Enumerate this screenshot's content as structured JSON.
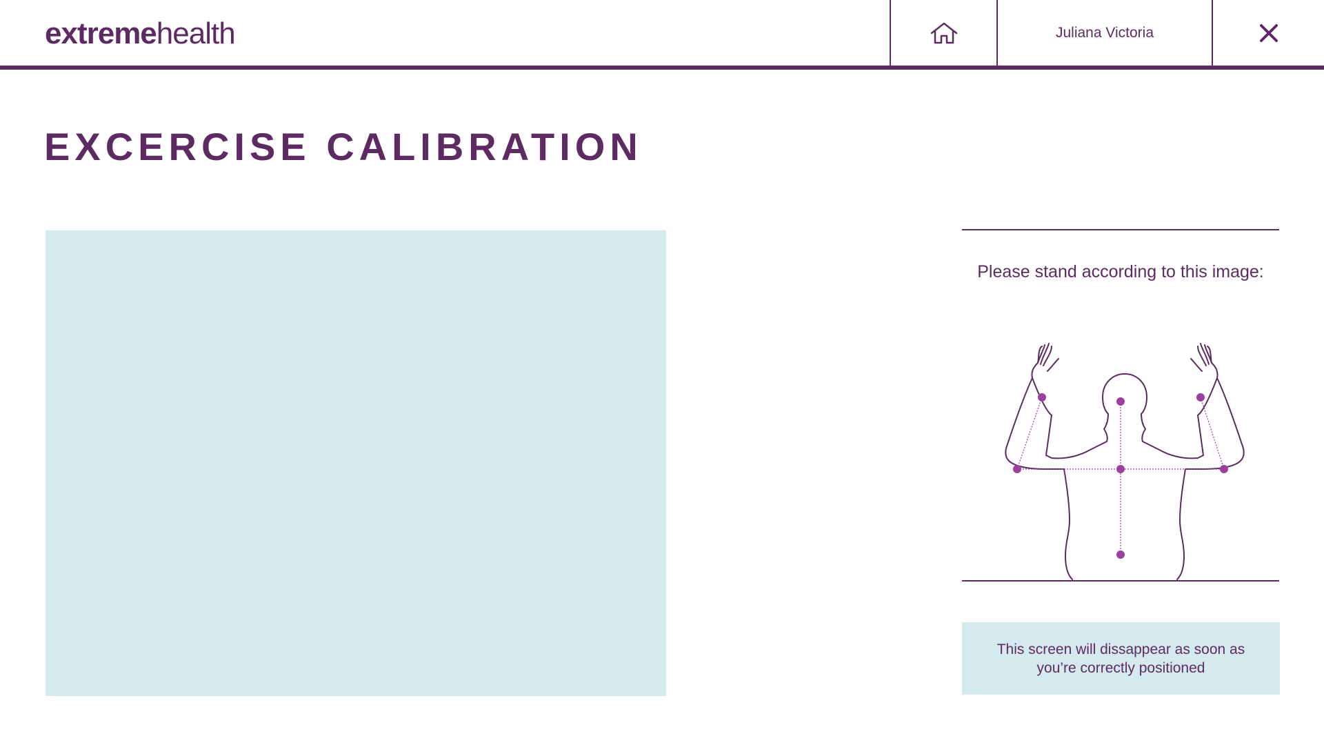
{
  "brand": {
    "logo_bold": "extreme",
    "logo_light": "health"
  },
  "header": {
    "home_icon": "home-icon",
    "user_name": "Juliana Victoria",
    "close_icon": "close-icon"
  },
  "page": {
    "title": "EXCERCISE CALIBRATION"
  },
  "guide": {
    "instruction": "Please stand according to this image:",
    "figure_icon": "body-pose-figure"
  },
  "notice": {
    "text": "This screen will dissappear as soon as you’re correctly positioned"
  },
  "colors": {
    "primary": "#5e2a63",
    "accent_dot": "#9b3fa0",
    "panel_bg": "#d4eaee",
    "background": "#ffffff"
  }
}
